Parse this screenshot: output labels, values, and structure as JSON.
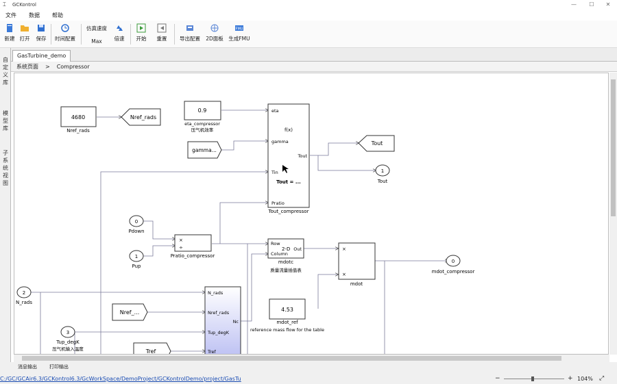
{
  "window": {
    "title": "GCKontrol"
  },
  "menu": [
    "文件",
    "数据",
    "帮助"
  ],
  "toolbar": {
    "new": "新建",
    "open": "打开",
    "save": "保存",
    "time_config": "时间配置",
    "sim_speed_label": "仿真速度",
    "max": "Max",
    "multiplier": "倍速",
    "start": "开始",
    "reset": "重置",
    "export_config": "导出配置",
    "panel_2d": "2D面板",
    "gen_fmu": "生成FMU"
  },
  "side_tabs": [
    "自定义库",
    "模型库",
    "子系统视图"
  ],
  "tab": {
    "label": "GasTurbine_demo"
  },
  "breadcrumb": {
    "root": "系统页面",
    "sep": ">",
    "current": "Compressor"
  },
  "diagram": {
    "const_nref": "4680",
    "label_nref_const": "Nref_rads",
    "goto_nref": "Nref_rads",
    "const_eta": "0.9",
    "label_eta": "eta_compressor",
    "label_eta_cn": "压气机效率",
    "from_gamma": "gamma...",
    "fcn_port_eta": "eta",
    "fcn_fx": "f(x)",
    "fcn_port_gamma": "gamma",
    "fcn_port_tout": "Tout",
    "fcn_port_tin": "Tin",
    "fcn_expr": "Tout = ...",
    "fcn_port_pratio": "Pratio",
    "fcn_name": "Tout_compressor",
    "goto_tout": "Tout",
    "out_tout_num": "1",
    "out_tout_label": "Tout",
    "in_pdown_num": "0",
    "in_pdown_label": "Pdown",
    "in_pup_num": "1",
    "in_pup_label": "Pup",
    "prod_x": "×",
    "prod_div": "÷",
    "pratio_name": "Pratio_compressor",
    "lut_row": "Row",
    "lut_2d": "2-D",
    "lut_out": "Out",
    "lut_col": "Column",
    "lut_name": "mdotc",
    "lut_desc": "质量流量插值表",
    "mul_x1": "×",
    "mul_x2": "×",
    "mul_name": "mdot",
    "out_mdot_num": "0",
    "out_mdot_label": "mdot_compressor",
    "const_mdotref": "4.53",
    "label_mdotref": "mdot_ref",
    "label_mdotref_desc": "reference mass flow for the table",
    "in_nrads_num": "2",
    "in_nrads_label": "N_rads",
    "in_tup_num": "3",
    "in_tup_label": "Tup_degK",
    "in_tup_cn": "压气机输入温度",
    "from_nref": "Nref_...",
    "from_tref": "Tref",
    "sub_p1": "N_rads",
    "sub_p2": "Nref_rads",
    "sub_p3": "Tup_degK",
    "sub_p4": "Tref",
    "sub_out": "Nc"
  },
  "status": {
    "path": "C:/GC/GCAir6.3/GCKontrol6.3/GcWorkSpace/DemoProject/GCKontrolDemo/project/GasTu",
    "zoom": "104%",
    "panel_a": "消息输出",
    "panel_b": "打印输出"
  },
  "colors": {
    "accent": "#1a6fc4",
    "block_fill_sub": "#c9ccf5",
    "line": "#555555"
  }
}
